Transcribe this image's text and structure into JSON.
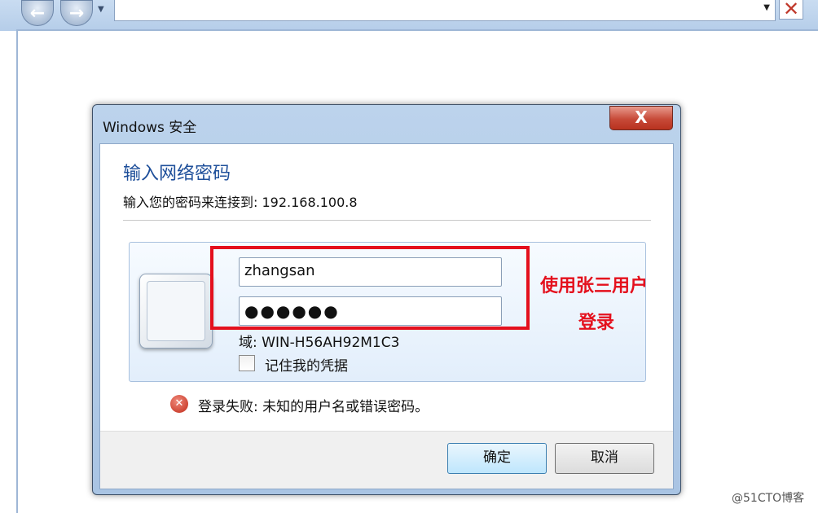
{
  "browser": {
    "back_icon": "arrow-left-icon",
    "forward_icon": "arrow-right-icon",
    "close_icon": "close-icon"
  },
  "dialog": {
    "title": "Windows 安全",
    "close_glyph": "X",
    "heading": "输入网络密码",
    "subtitle": "输入您的密码来连接到: 192.168.100.8",
    "username_value": "zhangsan",
    "password_value": "●●●●●●",
    "domain_text": "域: WIN-H56AH92M1C3",
    "remember_label": "记住我的凭据",
    "remember_checked": false,
    "error_icon": "error-icon",
    "error_text": "登录失败: 未知的用户名或错误密码。",
    "ok_label": "确定",
    "cancel_label": "取消"
  },
  "annotation": {
    "line1": "使用张三用户",
    "line2": "登录",
    "color": "#e4101d"
  },
  "watermark": "@51CTO博客"
}
